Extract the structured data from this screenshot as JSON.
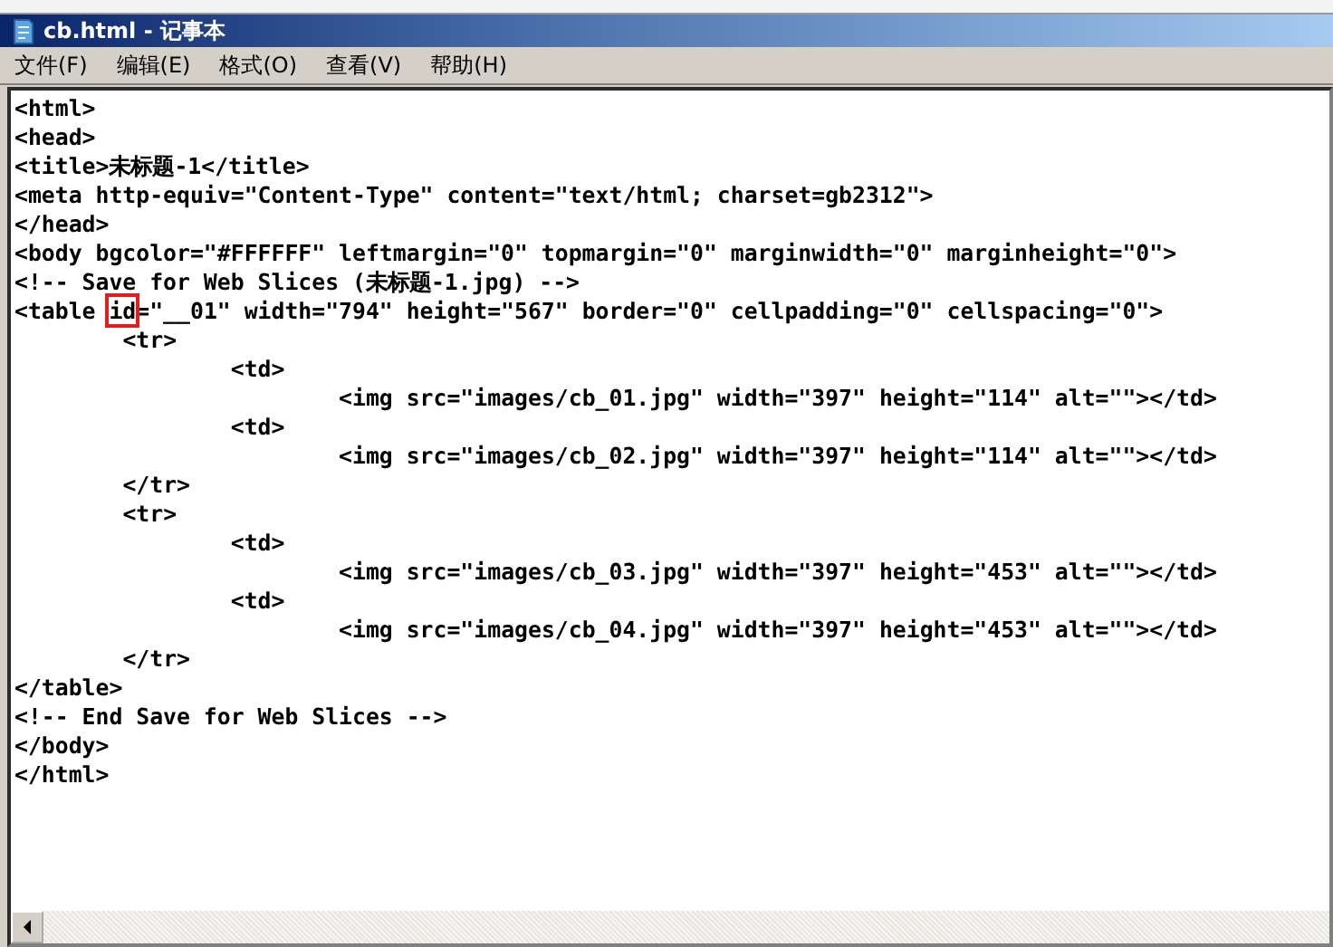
{
  "window": {
    "title": "cb.html - 记事本"
  },
  "menu": [
    {
      "label": "文件(F)"
    },
    {
      "label": "编辑(E)"
    },
    {
      "label": "格式(O)"
    },
    {
      "label": "查看(V)"
    },
    {
      "label": "帮助(H)"
    }
  ],
  "lines": [
    {
      "text": "<html>"
    },
    {
      "text": "<head>"
    },
    {
      "text": "<title>未标题-1</title>"
    },
    {
      "text": "<meta http-equiv=\"Content-Type\" content=\"text/html; charset=gb2312\">"
    },
    {
      "text": "</head>"
    },
    {
      "text": "<body bgcolor=\"#FFFFFF\" leftmargin=\"0\" topmargin=\"0\" marginwidth=\"0\" marginheight=\"0\">"
    },
    {
      "text": "<!-- Save for Web Slices (未标题-1.jpg) -->"
    },
    {
      "text": "<table ",
      "highlight": "id",
      "after": "=\"__01\" width=\"794\" height=\"567\" border=\"0\" cellpadding=\"0\" cellspacing=\"0\">"
    },
    {
      "text": "\t<tr>"
    },
    {
      "text": "\t\t<td>"
    },
    {
      "text": "\t\t\t<img src=\"images/cb_01.jpg\" width=\"397\" height=\"114\" alt=\"\"></td>"
    },
    {
      "text": "\t\t<td>"
    },
    {
      "text": "\t\t\t<img src=\"images/cb_02.jpg\" width=\"397\" height=\"114\" alt=\"\"></td>"
    },
    {
      "text": "\t</tr>"
    },
    {
      "text": "\t<tr>"
    },
    {
      "text": "\t\t<td>"
    },
    {
      "text": "\t\t\t<img src=\"images/cb_03.jpg\" width=\"397\" height=\"453\" alt=\"\"></td>"
    },
    {
      "text": "\t\t<td>"
    },
    {
      "text": "\t\t\t<img src=\"images/cb_04.jpg\" width=\"397\" height=\"453\" alt=\"\"></td>"
    },
    {
      "text": "\t</tr>"
    },
    {
      "text": "</table>"
    },
    {
      "text": "<!-- End Save for Web Slices -->"
    },
    {
      "text": "</body>"
    },
    {
      "text": "</html>"
    }
  ]
}
